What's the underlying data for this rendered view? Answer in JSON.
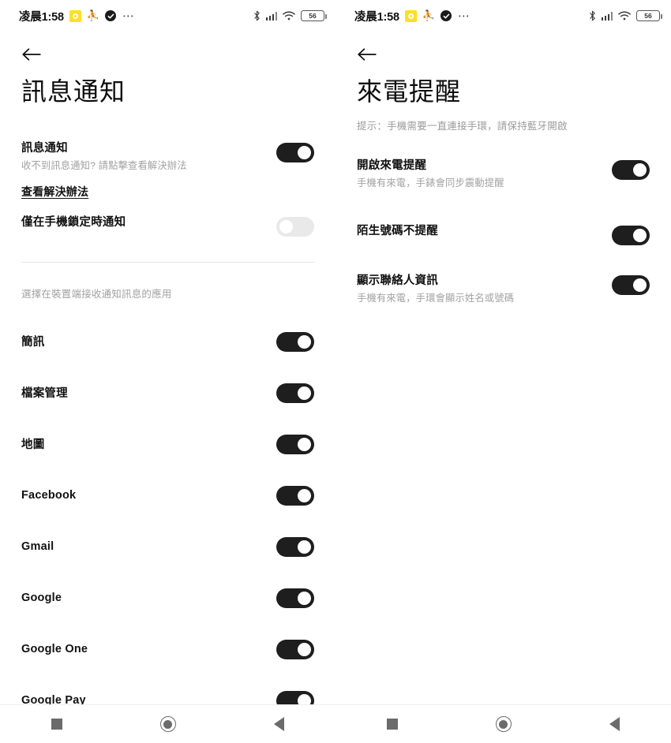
{
  "statusbar": {
    "time": "凌晨1:58",
    "icons": [
      "notification-app-icon",
      "gmail-icon",
      "check-circle-icon",
      "more-dots-icon"
    ],
    "bluetooth": "bluetooth-icon",
    "signal": "cellular-signal-icon",
    "wifi": "wifi-icon",
    "battery_level": "56"
  },
  "left": {
    "back_label": "返回",
    "title": "訊息通知",
    "primary": {
      "title": "訊息通知",
      "subtitle": "收不到訊息通知? 請點擊查看解決辦法",
      "toggle": "on"
    },
    "link": "查看解決辦法",
    "lock_only": {
      "title": "僅在手機鎖定時通知",
      "toggle": "off"
    },
    "section_label": "選擇在裝置端接收通知訊息的應用",
    "apps": [
      {
        "name": "簡訊",
        "toggle": "on"
      },
      {
        "name": "檔案管理",
        "toggle": "on"
      },
      {
        "name": "地圖",
        "toggle": "on"
      },
      {
        "name": "Facebook",
        "toggle": "on"
      },
      {
        "name": "Gmail",
        "toggle": "on"
      },
      {
        "name": "Google",
        "toggle": "on"
      },
      {
        "name": "Google One",
        "toggle": "on"
      },
      {
        "name": "Google Pay",
        "toggle": "on"
      }
    ]
  },
  "right": {
    "back_label": "返回",
    "title": "來電提醒",
    "hint": "提示：手機需要一直連接手環，請保持藍牙開啟",
    "rows": [
      {
        "title": "開啟來電提醒",
        "subtitle": "手機有來電，手錶會同步震動提醒",
        "toggle": "on"
      },
      {
        "title": "陌生號碼不提醒",
        "subtitle": "",
        "toggle": "on"
      },
      {
        "title": "顯示聯絡人資訊",
        "subtitle": "手機有來電，手環會顯示姓名或號碼",
        "toggle": "on"
      }
    ]
  },
  "navbar": {
    "recents": "recents-square-icon",
    "home": "home-circle-icon",
    "back": "back-triangle-icon"
  },
  "colors": {
    "toggle_on": "#1e1e1e",
    "toggle_off": "#e9e9e9",
    "accent_yellow": "#ffe01f",
    "text_primary": "#111111",
    "text_muted": "#a2a2a2"
  }
}
